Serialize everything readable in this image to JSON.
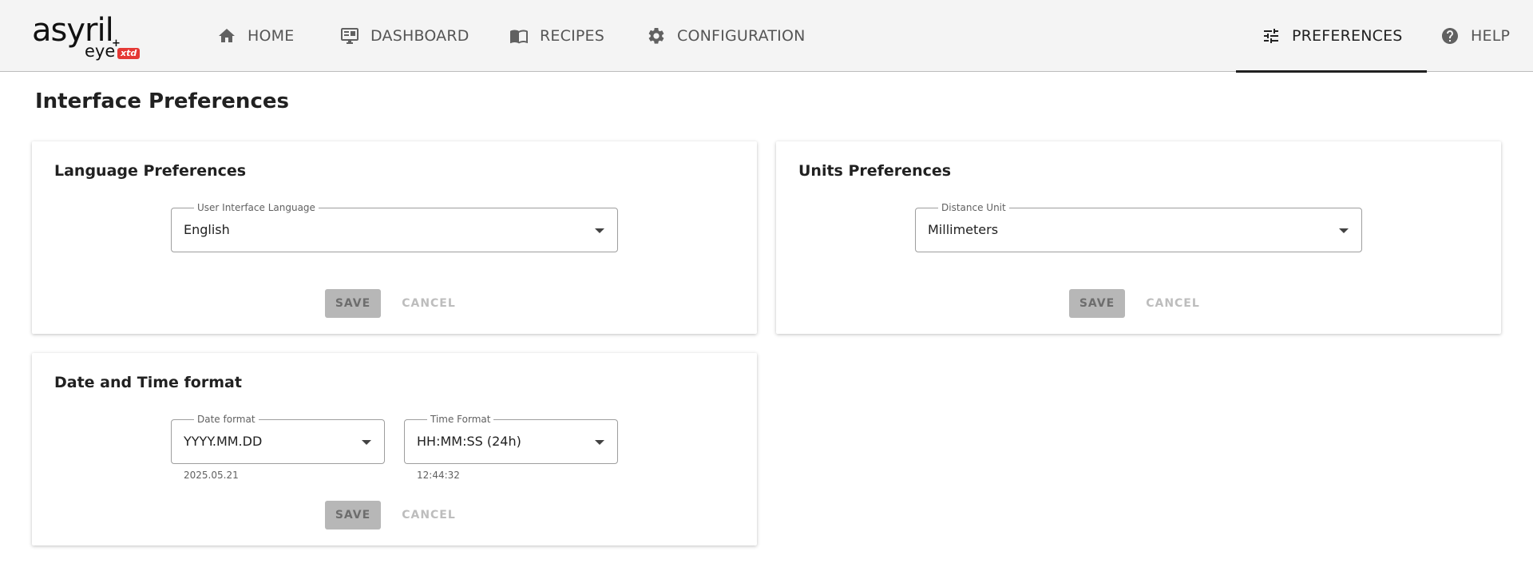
{
  "brand": {
    "name": "asyril",
    "product": "eye",
    "plus": "+",
    "badge": "xtd"
  },
  "nav": {
    "home": "HOME",
    "dashboard": "DASHBOARD",
    "recipes": "RECIPES",
    "configuration": "CONFIGURATION",
    "preferences": "PREFERENCES",
    "help": "HELP",
    "active": "PREFERENCES"
  },
  "page": {
    "title": "Interface Preferences"
  },
  "language_card": {
    "title": "Language Preferences",
    "field_label": "User Interface Language",
    "field_value": "English",
    "save": "SAVE",
    "cancel": "CANCEL"
  },
  "units_card": {
    "title": "Units Preferences",
    "field_label": "Distance Unit",
    "field_value": "Millimeters",
    "save": "SAVE",
    "cancel": "CANCEL"
  },
  "datetime_card": {
    "title": "Date and Time format",
    "date_label": "Date format",
    "date_value": "YYYY.MM.DD",
    "date_example": "2025.05.21",
    "time_label": "Time Format",
    "time_value": "HH:MM:SS (24h)",
    "time_example": "12:44:32",
    "save": "SAVE",
    "cancel": "CANCEL"
  },
  "colors": {
    "accent": "#e53935",
    "header_bg": "#f4f4f4",
    "disabled_button": "#b7b7b7"
  }
}
